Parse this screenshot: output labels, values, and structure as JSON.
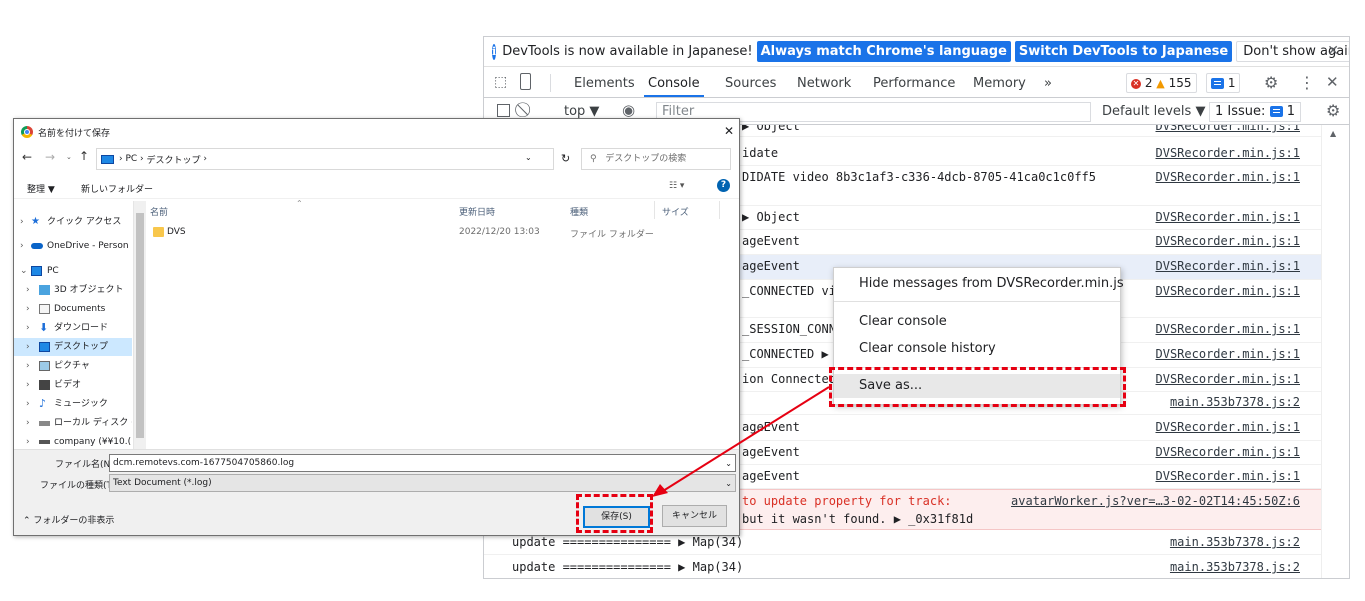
{
  "devtools": {
    "infobar": {
      "message": "DevTools is now available in Japanese!",
      "btn_match": "Always match Chrome's language",
      "btn_switch": "Switch DevTools to Japanese",
      "btn_dont_show": "Don't show again"
    },
    "tabs": [
      "Elements",
      "Console",
      "Sources",
      "Network",
      "Performance",
      "Memory"
    ],
    "more_tabs": "»",
    "counts": {
      "errors": "2",
      "warnings": "155",
      "messages": "1"
    },
    "toolbar": {
      "context": "top ▼",
      "filter_placeholder": "Filter",
      "levels": "Default levels ▼",
      "issues": "1 Issue:",
      "issues_count": "1"
    },
    "rows": [
      {
        "text": "▶ Object",
        "src": "DVSRecorder.min.js:1"
      },
      {
        "text": "idate",
        "src": "DVSRecorder.min.js:1"
      },
      {
        "text": "DIDATE video 8b3c1af3-c336-4dcb-8705-41ca0c1c0ff5",
        "src": "DVSRecorder.min.js:1"
      },
      {
        "text": "▶ Object",
        "src": "DVSRecorder.min.js:1"
      },
      {
        "text": "ageEvent",
        "src": "DVSRecorder.min.js:1"
      },
      {
        "text": "ageEvent",
        "src": "DVSRecorder.min.js:1"
      },
      {
        "text": "_CONNECTED vi",
        "src": "DVSRecorder.min.js:1"
      },
      {
        "text": "_SESSION_CONN",
        "src": "DVSRecorder.min.js:1"
      },
      {
        "text": "_CONNECTED ▶",
        "src": "DVSRecorder.min.js:1"
      },
      {
        "text": "ion Connected",
        "src": "DVSRecorder.min.js:1"
      },
      {
        "text": "",
        "src": "main.353b7378.js:2"
      },
      {
        "text": "ageEvent",
        "src": "DVSRecorder.min.js:1"
      },
      {
        "text": "ageEvent",
        "src": "DVSRecorder.min.js:1"
      },
      {
        "text": "ageEvent",
        "src": "DVSRecorder.min.js:1"
      },
      {
        "text": "to update property for track:",
        "text2": " but it wasn't found. ▶ _0x31f81d",
        "src": "avatarWorker.js?ver=…3-02-02T14:45:50Z:6"
      },
      {
        "text": "update =============== ▶ Map(34)",
        "src": "main.353b7378.js:2"
      },
      {
        "text": "update =============== ▶ Map(34)",
        "src": "main.353b7378.js:2"
      }
    ]
  },
  "context_menu": {
    "items": [
      "Hide messages from DVSRecorder.min.js",
      "Clear console",
      "Clear console history",
      "Save as..."
    ]
  },
  "dialog": {
    "title": "名前を付けて保存",
    "breadcrumb": [
      "PC",
      "デスクトップ"
    ],
    "search_placeholder": "デスクトップの検索",
    "organize": "整理 ▼",
    "new_folder": "新しいフォルダー",
    "columns": [
      "名前",
      "更新日時",
      "種類",
      "サイズ"
    ],
    "nav": [
      "クイック アクセス",
      "OneDrive - Person",
      "PC",
      "3D オブジェクト",
      "Documents",
      "ダウンロード",
      "デスクトップ",
      "ピクチャ",
      "ビデオ",
      "ミュージック",
      "ローカル ディスク (C",
      "company (¥¥10.("
    ],
    "files": [
      {
        "name": "DVS",
        "date": "2022/12/20 13:03",
        "type": "ファイル フォルダー"
      }
    ],
    "filename_label": "ファイル名(N):",
    "filename_value": "dcm.remotevs.com-1677504705860.log",
    "filetype_label": "ファイルの種類(T):",
    "filetype_value": "Text Document (*.log)",
    "hide_folders": "フォルダーの非表示",
    "save_button": "保存(S)",
    "cancel_button": "キャンセル"
  },
  "colors": {
    "accent": "#1a73e8",
    "annotation_red": "#e60012",
    "error_text": "#d93025"
  }
}
